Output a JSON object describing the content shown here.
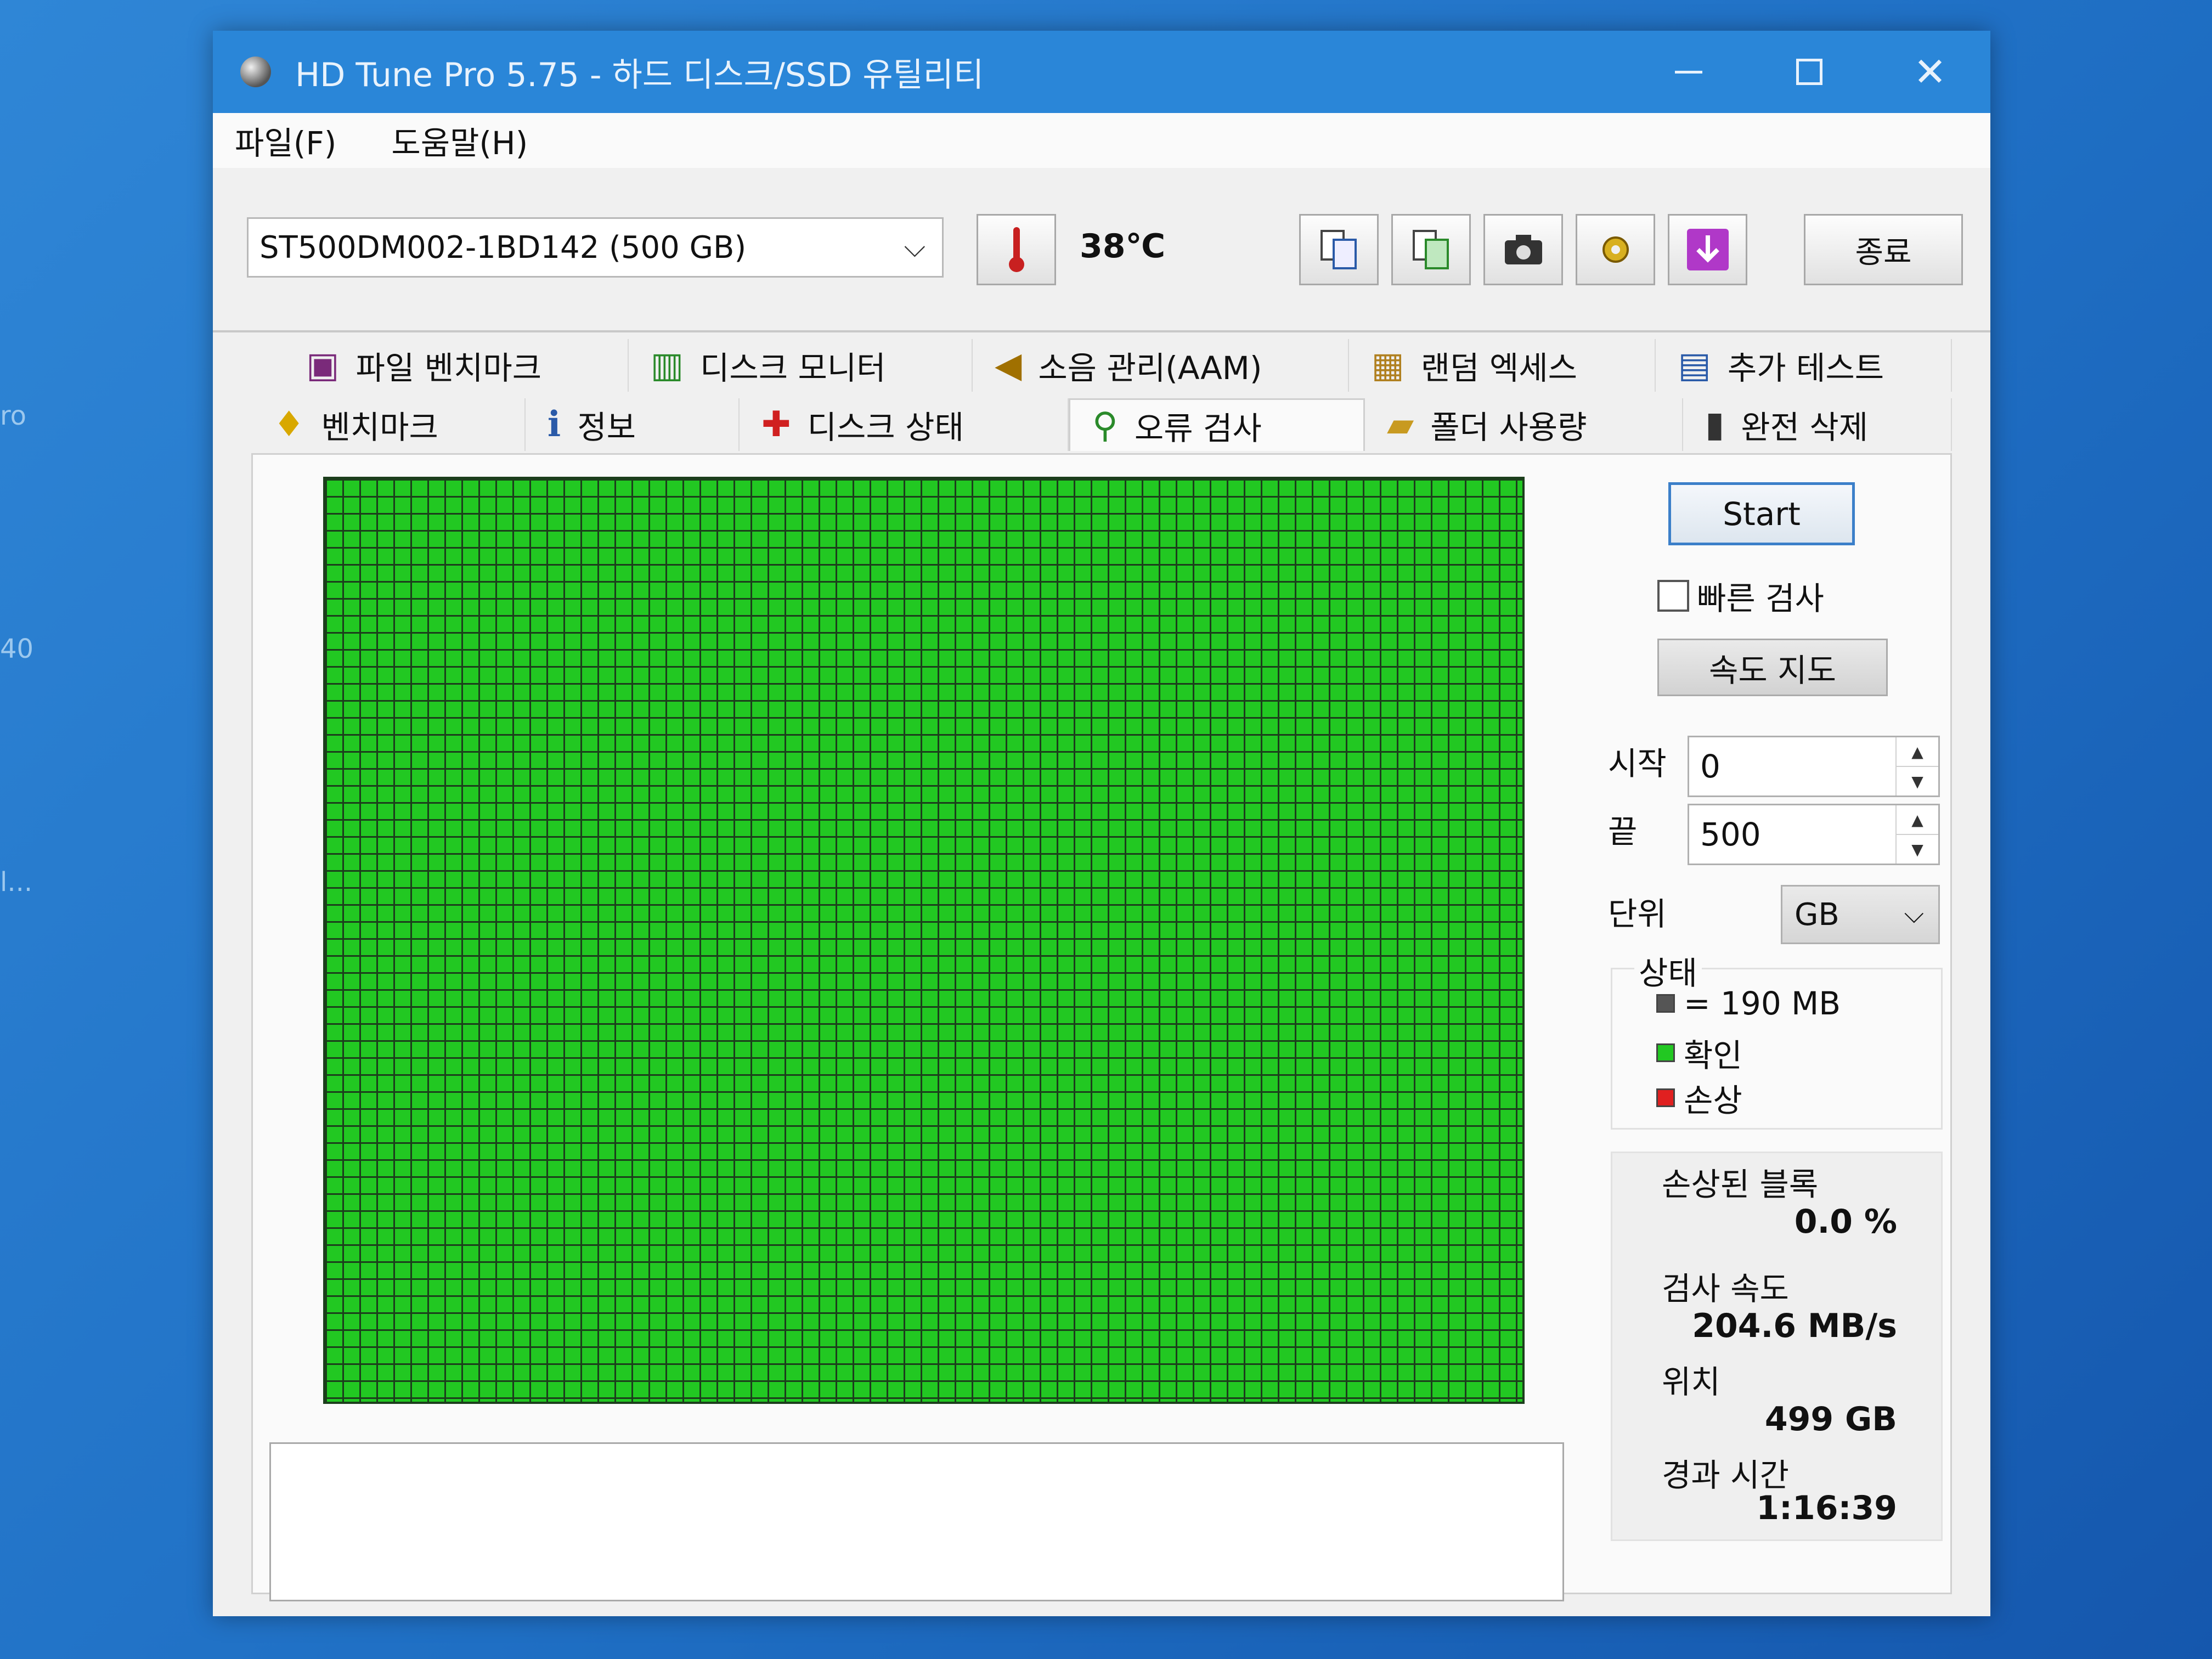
{
  "desktop": {
    "fragment_1": "ro",
    "fragment_2": "40",
    "fragment_3": "l..."
  },
  "window": {
    "title": "HD Tune Pro 5.75 - 하드 디스크/SSD 유틸리티",
    "close_glyph": "✕"
  },
  "menu": {
    "file": "파일(F)",
    "help": "도움말(H)"
  },
  "toolbar": {
    "drive": "ST500DM002-1BD142 (500 GB)",
    "temperature": "38℃",
    "exit_label": "종료"
  },
  "tabs": {
    "row1": [
      {
        "label": "파일 벤치마크"
      },
      {
        "label": "디스크 모니터"
      },
      {
        "label": "소음 관리(AAM)"
      },
      {
        "label": "랜덤 엑세스"
      },
      {
        "label": "추가 테스트"
      }
    ],
    "row2": [
      {
        "label": "벤치마크"
      },
      {
        "label": "정보"
      },
      {
        "label": "디스크 상태"
      },
      {
        "label": "오류 검사"
      },
      {
        "label": "폴더 사용량"
      },
      {
        "label": "완전 삭제"
      }
    ],
    "active": "오류 검사"
  },
  "controls": {
    "start_label": "Start",
    "quick_check_label": "빠른 검사",
    "quick_check_checked": false,
    "speed_map_label": "속도 지도",
    "start_field_label": "시작",
    "start_value": "0",
    "end_field_label": "끝",
    "end_value": "500",
    "unit_label": "단위",
    "unit_value": "GB"
  },
  "status": {
    "legend_title": "상태",
    "block_size": "= 190 MB",
    "ok_label": "확인",
    "damaged_label": "손상",
    "colors": {
      "block": "#555555",
      "ok": "#22c822",
      "damaged": "#e02020"
    }
  },
  "stats": {
    "damaged_blocks_label": "손상된 블록",
    "damaged_blocks_value": "0.0 %",
    "scan_speed_label": "검사 속도",
    "scan_speed_value": "204.6 MB/s",
    "position_label": "위치",
    "position_value": "499 GB",
    "elapsed_label": "경과 시간",
    "elapsed_value": "1:16:39"
  }
}
